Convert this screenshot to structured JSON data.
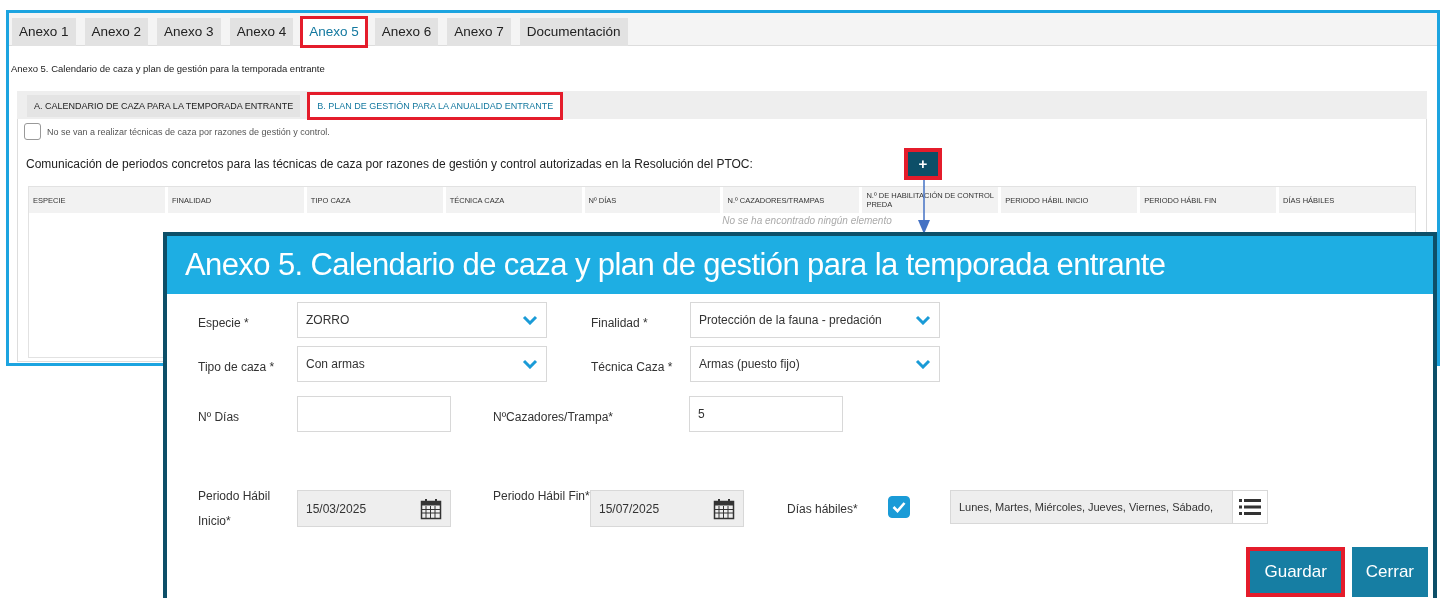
{
  "tabs": [
    {
      "label": "Anexo 1",
      "selected": false,
      "highlighted": false
    },
    {
      "label": "Anexo 2",
      "selected": false,
      "highlighted": false
    },
    {
      "label": "Anexo 3",
      "selected": false,
      "highlighted": false
    },
    {
      "label": "Anexo 4",
      "selected": false,
      "highlighted": false
    },
    {
      "label": "Anexo 5",
      "selected": true,
      "highlighted": true
    },
    {
      "label": "Anexo 6",
      "selected": false,
      "highlighted": false
    },
    {
      "label": "Anexo 7",
      "selected": false,
      "highlighted": false
    },
    {
      "label": "Documentación",
      "selected": false,
      "highlighted": false
    }
  ],
  "page_heading": "Anexo 5. Calendario de caza y plan de gestión para la temporada entrante",
  "subtabs": [
    {
      "label": "A. CALENDARIO DE CAZA PARA LA TEMPORADA ENTRANTE",
      "selected": false,
      "highlighted": false
    },
    {
      "label": "B. PLAN DE GESTIÓN PARA LA ANUALIDAD ENTRANTE",
      "selected": true,
      "highlighted": true
    }
  ],
  "no_techniques": {
    "label": "No se van a realizar técnicas de caza por razones de gestión y control.",
    "checked": false
  },
  "section_title": "Comunicación de periodos concretos para las técnicas de caza por razones de gestión y control autorizadas en la Resolución del PTOC:",
  "add_button": {
    "label": "+",
    "highlighted": true
  },
  "table": {
    "columns": [
      "ESPECIE",
      "FINALIDAD",
      "TIPO CAZA",
      "TÉCNICA CAZA",
      "Nº DÍAS",
      "N.º CAZADORES/TRAMPAS",
      "N.º DE HABILITACIÓN DE CONTROL PREDA",
      "PERIODO HÁBIL INICIO",
      "PERIODO HÁBIL FIN",
      "DÍAS HÁBILES"
    ],
    "empty_message": "No se ha encontrado ningún elemento"
  },
  "modal": {
    "title": "Anexo 5. Calendario de caza y plan de gestión para la temporada entrante",
    "rows": [
      [
        {
          "kind": "select",
          "label": "Especie *",
          "value": "ZORRO"
        },
        {
          "kind": "select",
          "label": "Finalidad *",
          "value": "Protección de la fauna - predación"
        }
      ],
      [
        {
          "kind": "select",
          "label": "Tipo de caza *",
          "value": "Con armas"
        },
        {
          "kind": "select",
          "label": "Técnica Caza *",
          "value": "Armas (puesto fijo)"
        }
      ],
      [
        {
          "kind": "text",
          "label": "Nº Días"
        },
        {
          "kind": "text",
          "label": "NºCazadores/Trampa*",
          "value": "5"
        }
      ],
      [
        {
          "kind": "date",
          "label": "Periodo Hábil Inicio*",
          "value": "15/03/2025"
        },
        {
          "kind": "date",
          "label": "Periodo Hábil Fin*",
          "value": "15/07/2025"
        },
        {
          "kind": "checklist",
          "label": "Días hábiles*",
          "checked": true,
          "value": "Lunes, Martes, Miércoles, Jueves, Viernes, Sábado,"
        }
      ]
    ],
    "buttons": [
      {
        "label": "Guardar",
        "highlighted": true
      },
      {
        "label": "Cerrar",
        "highlighted": false
      }
    ]
  }
}
